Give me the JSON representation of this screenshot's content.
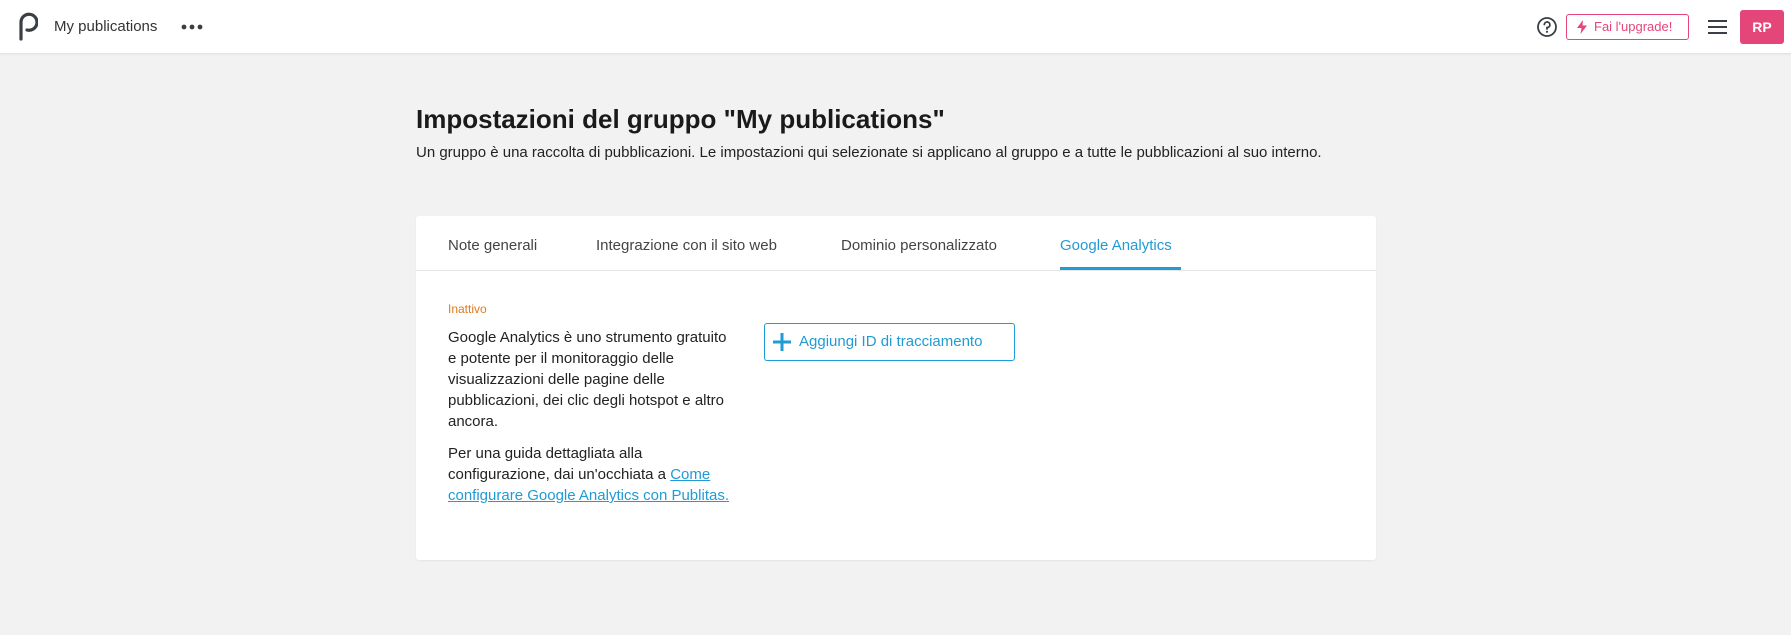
{
  "header": {
    "app_title": "My publications",
    "upgrade_label": "Fai l'upgrade!",
    "avatar_initials": "RP",
    "icons": [
      "publitas-logo-icon",
      "more-dots-icon",
      "help-icon",
      "lightning-icon",
      "hamburger-menu-icon"
    ]
  },
  "page": {
    "title": "Impostazioni del gruppo \"My publications\"",
    "description": "Un gruppo è una raccolta di pubblicazioni. Le impostazioni qui selezionate si applicano al gruppo e a tutte le pubblicazioni al suo interno."
  },
  "tabs": [
    {
      "label": "Note generali",
      "active": false
    },
    {
      "label": "Integrazione con il sito web",
      "active": false
    },
    {
      "label": "Dominio personalizzato",
      "active": false
    },
    {
      "label": "Google Analytics",
      "active": true
    }
  ],
  "analytics": {
    "status": "Inattivo",
    "description": "Google Analytics è uno strumento gratuito e potente per il monitoraggio delle visualizzazioni delle pagine delle pubblicazioni, dei clic degli hotspot e altro ancora.",
    "guide_prefix": "Per una guida dettagliata alla configurazione, dai un'occhiata a ",
    "guide_link": "Come configurare Google Analytics con Publitas.",
    "add_button_label": "Aggiungi ID di tracciamento"
  },
  "colors": {
    "accent_blue": "#1f9bd5",
    "brand_pink": "#e5467a",
    "status_orange": "#e07a1c",
    "page_background": "#f2f2f2"
  }
}
